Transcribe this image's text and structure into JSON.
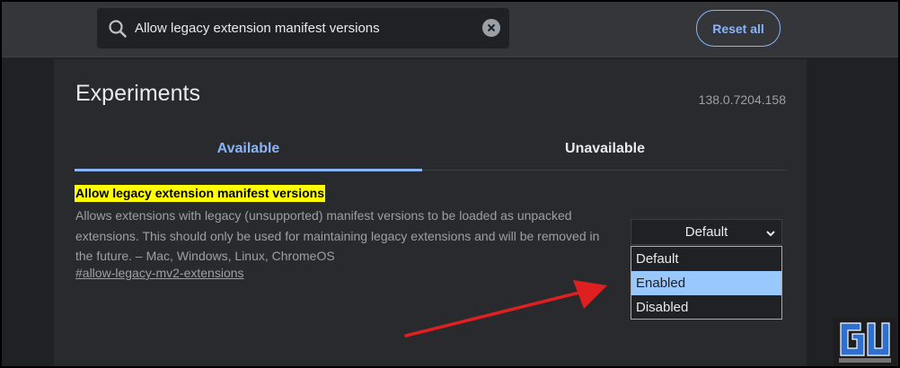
{
  "search": {
    "value": "Allow legacy extension manifest versions",
    "icon": "search-icon",
    "clear_icon": "clear-icon"
  },
  "header": {
    "reset_label": "Reset all"
  },
  "page": {
    "title": "Experiments",
    "version": "138.0.7204.158"
  },
  "tabs": [
    {
      "label": "Available",
      "active": true
    },
    {
      "label": "Unavailable",
      "active": false
    }
  ],
  "experiment": {
    "name": "Allow legacy extension manifest versions",
    "description": "Allows extensions with legacy (unsupported) manifest versions to be loaded as unpacked extensions. This should only be used for maintaining legacy extensions and will be removed in the future. – Mac, Windows, Linux, ChromeOS",
    "link": "#allow-legacy-mv2-extensions",
    "selected": "Default",
    "options": [
      "Default",
      "Enabled",
      "Disabled"
    ],
    "highlighted_option": "Enabled"
  },
  "colors": {
    "accent": "#8ab4f8",
    "highlight_name": "#ffff00",
    "option_highlight": "#99c8ff",
    "arrow": "#e02020"
  }
}
